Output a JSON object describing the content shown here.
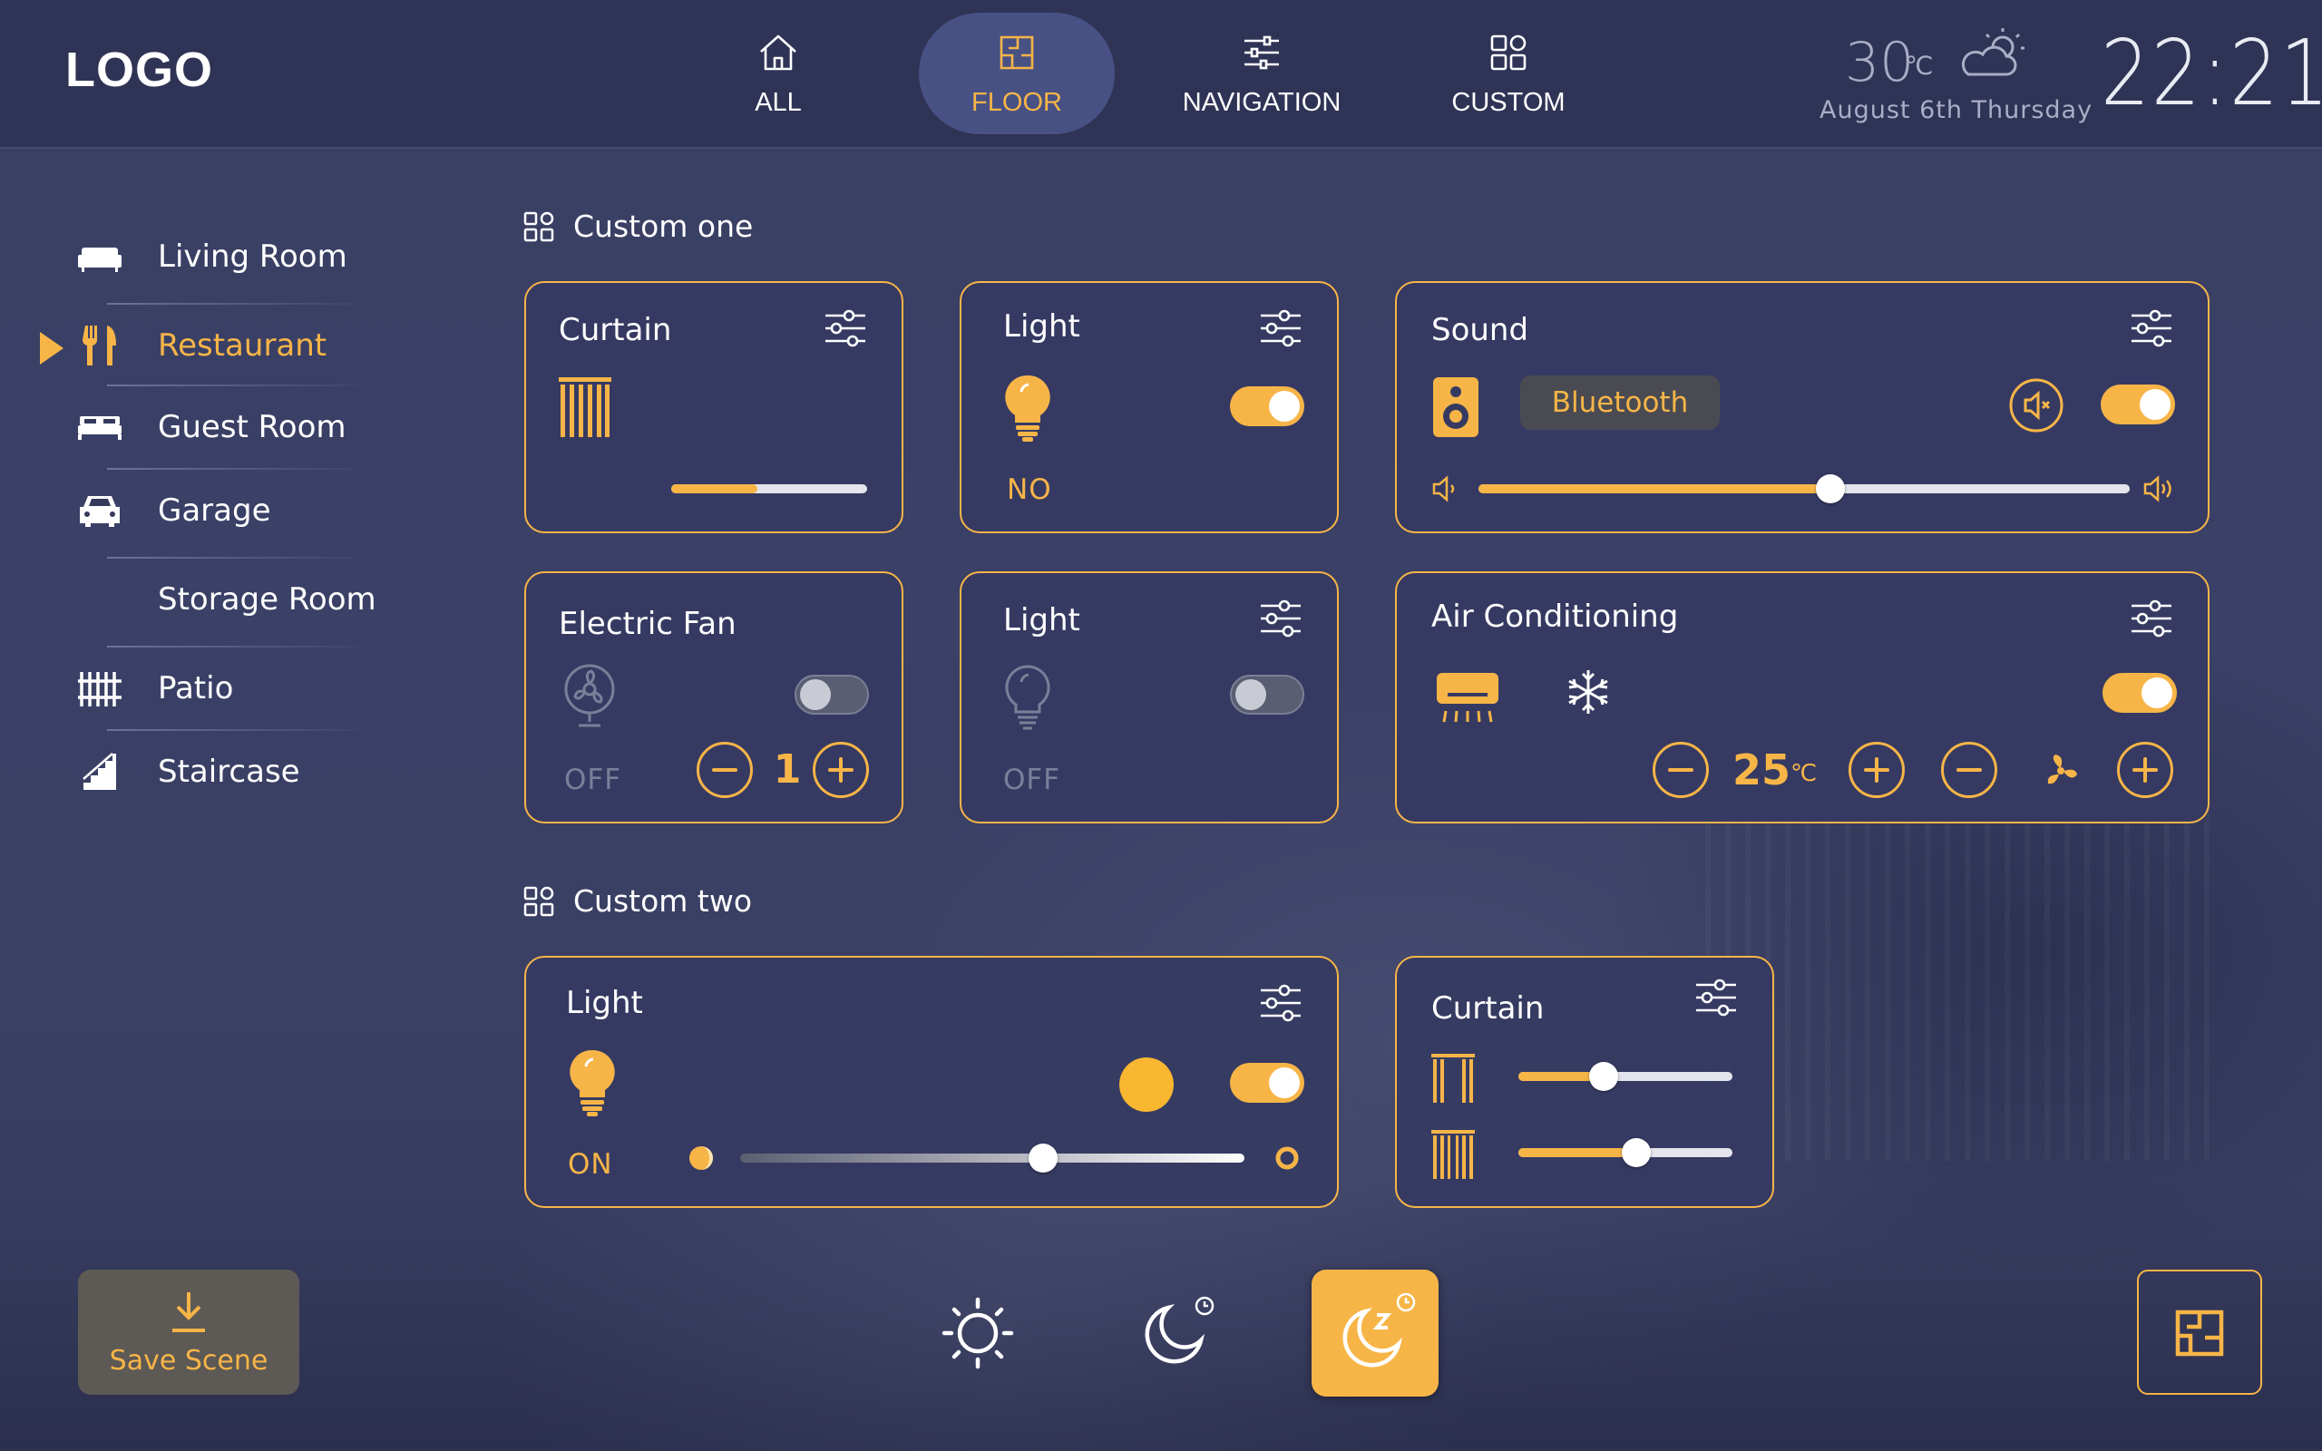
{
  "header": {
    "logo": "LOGO",
    "tabs": [
      {
        "label": "ALL",
        "icon": "home-icon"
      },
      {
        "label": "FLOOR",
        "icon": "floorplan-icon",
        "active": true
      },
      {
        "label": "NAVIGATION",
        "icon": "sliders-icon"
      },
      {
        "label": "CUSTOM",
        "icon": "grid-icon"
      }
    ],
    "weather": {
      "temp": "30",
      "unit": "℃",
      "icon": "partly-cloudy-icon",
      "date": "August  6th  Thursday"
    },
    "clock": "22:21"
  },
  "sidebar": {
    "items": [
      {
        "label": "Living Room",
        "icon": "sofa-icon"
      },
      {
        "label": "Restaurant",
        "icon": "fork-knife-icon",
        "active": true
      },
      {
        "label": "Guest Room",
        "icon": "bed-icon"
      },
      {
        "label": "Garage",
        "icon": "car-icon"
      },
      {
        "label": "Storage Room",
        "icon": ""
      },
      {
        "label": "Patio",
        "icon": "fence-icon"
      },
      {
        "label": "Staircase",
        "icon": "stairs-icon"
      }
    ]
  },
  "sections": {
    "custom_one": "Custom one",
    "custom_two": "Custom two"
  },
  "cards": {
    "curtain1": {
      "title": "Curtain",
      "level": 0.44
    },
    "light1": {
      "title": "Light",
      "state": "NO",
      "on": true
    },
    "sound": {
      "title": "Sound",
      "source": "Bluetooth",
      "on": true,
      "volume": 0.54
    },
    "fan": {
      "title": "Electric Fan",
      "state": "OFF",
      "on": false,
      "speed": "1"
    },
    "light2": {
      "title": "Light",
      "state": "OFF",
      "on": false
    },
    "ac": {
      "title": "Air Conditioning",
      "mode": "snowflake-icon",
      "temp": "25",
      "unit": "℃",
      "on": true
    },
    "light3": {
      "title": "Light",
      "state": "ON",
      "on": true,
      "brightness": 0.6,
      "color": "#f9b731"
    },
    "curtain2": {
      "title": "Curtain",
      "inner_level": 0.4,
      "outer_level": 0.55
    }
  },
  "footer": {
    "save_scene": "Save Scene",
    "scenes": [
      "sun-icon",
      "moon-icon",
      "sleep-icon"
    ]
  },
  "colors": {
    "accent": "#f7b548",
    "bar": "#2f3355",
    "card": "#363a62"
  }
}
